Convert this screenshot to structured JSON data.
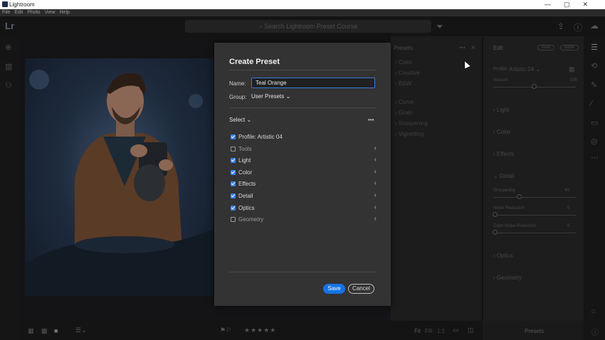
{
  "window": {
    "app_title": "Lightroom",
    "menu": [
      "File",
      "Edit",
      "Photo",
      "View",
      "Help"
    ],
    "controls": [
      "—",
      "▢",
      "✕"
    ]
  },
  "toolbar": {
    "logo": "Lr",
    "search_placeholder": "Search Lightroom Preset Course"
  },
  "presets_panel": {
    "title": "Presets",
    "items": [
      "Color",
      "Creative",
      "B&W",
      "Curve",
      "Grain",
      "Sharpening",
      "Vignetting"
    ]
  },
  "edit_panel": {
    "title": "Edit",
    "auto_label": "Auto",
    "bw_label": "B&W",
    "profile_label": "Profile",
    "profile_value": "Artistic 04",
    "amount_label": "Amount",
    "amount_value": "100",
    "sections": [
      "Light",
      "Color",
      "Effects",
      "Detail",
      "Optics",
      "Geometry"
    ],
    "detail_sliders": [
      {
        "label": "Sharpening",
        "value": "40"
      },
      {
        "label": "Noise Reduction",
        "value": "0"
      },
      {
        "label": "Color Noise Reduction",
        "value": "0"
      }
    ]
  },
  "bottom_bar": {
    "fit": "Fit",
    "fill": "Fill",
    "ratio": "1:1",
    "stars": "★★★★★",
    "presets_label": "Presets"
  },
  "modal": {
    "title": "Create Preset",
    "name_label": "Name:",
    "name_value": "Teal Orange",
    "group_label": "Group:",
    "group_value": "User Presets",
    "select_label": "Select",
    "more_label": "•••",
    "options": [
      {
        "label": "Profile: Artistic 04",
        "checked": true,
        "expandable": false
      },
      {
        "label": "Tools",
        "checked": false,
        "expandable": true
      },
      {
        "label": "Light",
        "checked": true,
        "expandable": true
      },
      {
        "label": "Color",
        "checked": true,
        "expandable": true
      },
      {
        "label": "Effects",
        "checked": true,
        "expandable": true
      },
      {
        "label": "Detail",
        "checked": true,
        "expandable": true
      },
      {
        "label": "Optics",
        "checked": true,
        "expandable": true
      },
      {
        "label": "Geometry",
        "checked": false,
        "expandable": true
      }
    ],
    "save_label": "Save",
    "cancel_label": "Cancel"
  },
  "colors": {
    "accent": "#1473e6",
    "checkbox": "#3b82f6",
    "modal_bg": "#333333",
    "app_bg": "#1a1a1a"
  }
}
